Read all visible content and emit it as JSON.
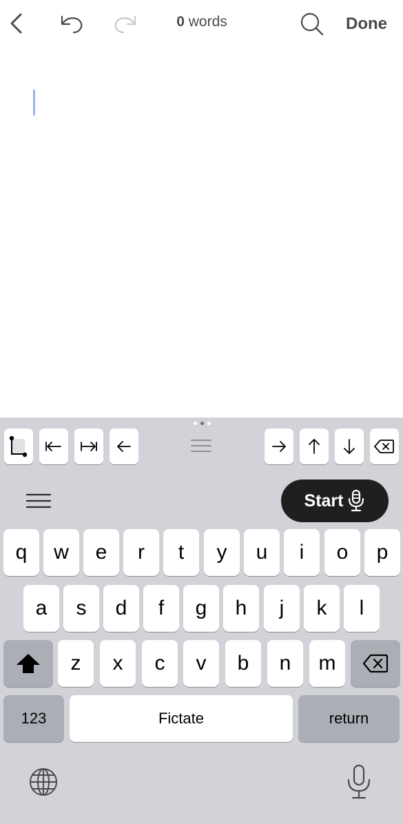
{
  "topbar": {
    "back_icon": "chevron-left-icon",
    "undo_icon": "undo-icon",
    "redo_icon": "redo-icon",
    "word_count_number": "0",
    "word_count_label": "words",
    "search_icon": "magnifier-icon",
    "done_label": "Done"
  },
  "editor": {
    "text": ""
  },
  "toolbar": {
    "tools": [
      "select-text-icon",
      "move-line-start-icon",
      "move-line-end-icon",
      "arrow-left-icon",
      "arrow-right-icon",
      "arrow-up-icon",
      "arrow-down-icon",
      "delete-icon"
    ],
    "start_label": "Start"
  },
  "keyboard": {
    "row1": [
      "q",
      "w",
      "e",
      "r",
      "t",
      "y",
      "u",
      "i",
      "o",
      "p"
    ],
    "row2": [
      "a",
      "s",
      "d",
      "f",
      "g",
      "h",
      "j",
      "k",
      "l"
    ],
    "row3": [
      "z",
      "x",
      "c",
      "v",
      "b",
      "n",
      "m"
    ],
    "numbers_label": "123",
    "space_label": "Fictate",
    "return_label": "return"
  },
  "colors": {
    "caret": "#9db4ec",
    "start_bg": "#1f1f1f",
    "keyboard_bg": "#d1d3d9"
  }
}
